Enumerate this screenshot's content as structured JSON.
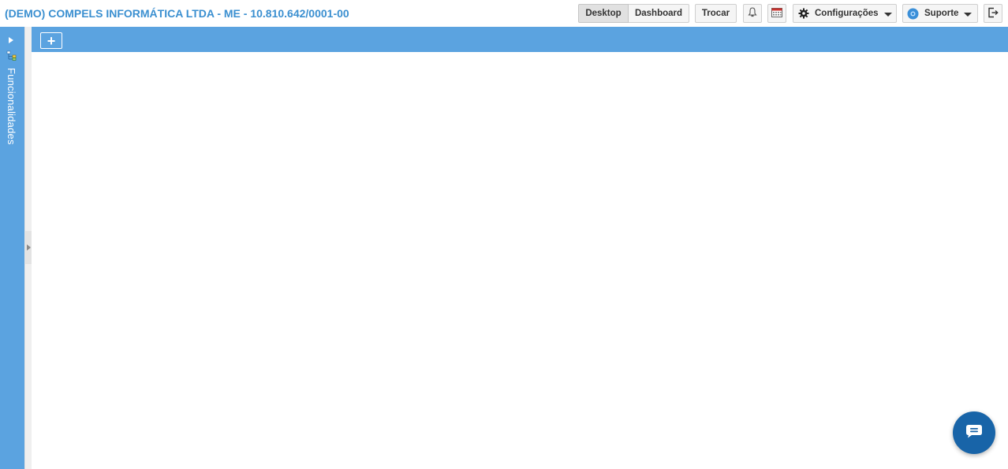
{
  "header": {
    "company": "(DEMO) COMPELS INFORMÁTICA LTDA - ME - 10.810.642/0001-00",
    "desktop_label": "Desktop",
    "dashboard_label": "Dashboard",
    "trocar_label": "Trocar",
    "configuracoes_label": "Configurações",
    "suporte_label": "Suporte"
  },
  "sidebar": {
    "label": "Funcionalidades"
  },
  "toolbar": {
    "add_label": "+"
  },
  "colors": {
    "accent": "#5ba3e0",
    "title": "#3a8fd0",
    "chat": "#1864a8"
  },
  "icons": [
    "bell-icon",
    "calendar-icon",
    "gear-icon",
    "support-icon",
    "logout-icon",
    "tree-icon",
    "chat-icon"
  ]
}
